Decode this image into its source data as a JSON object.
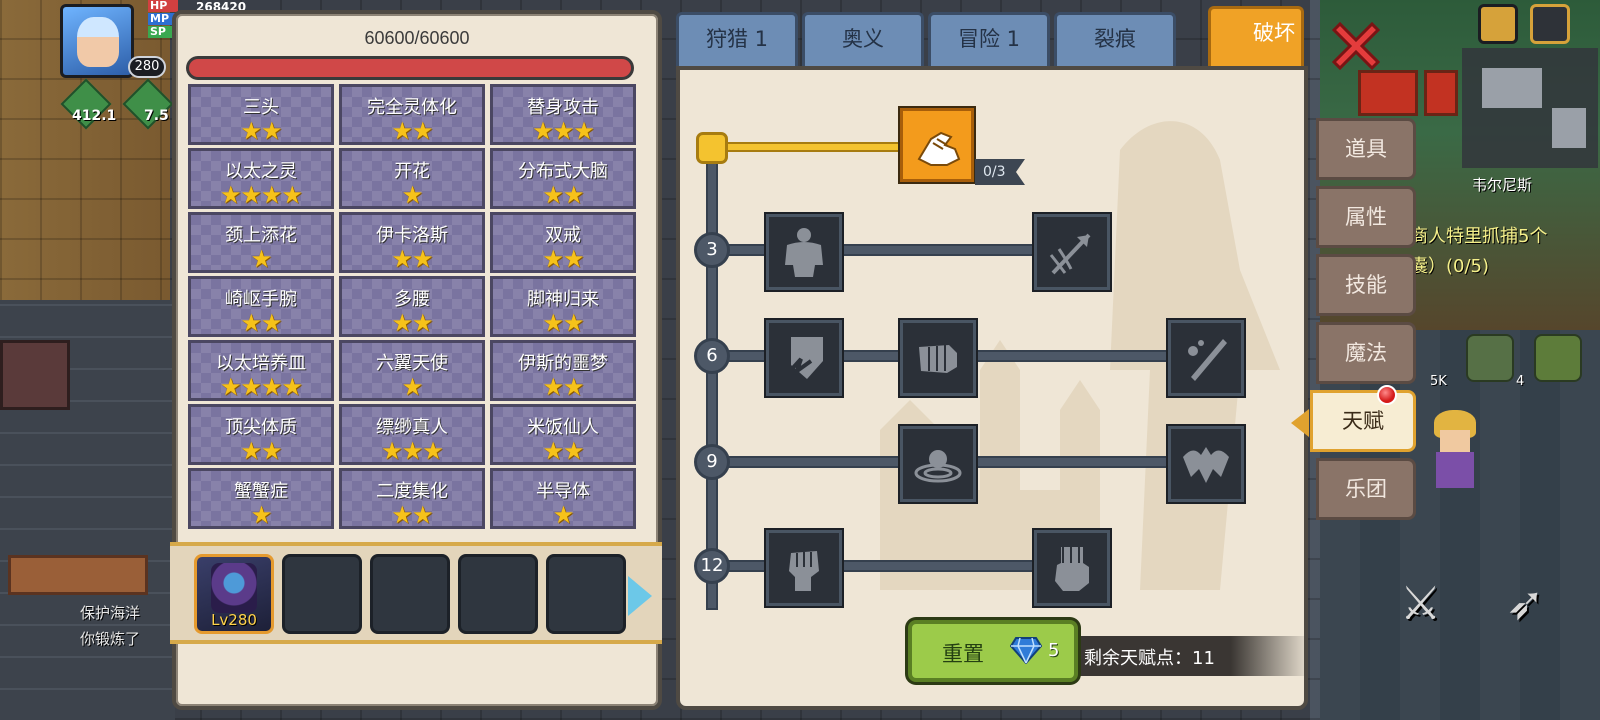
{
  "hud": {
    "hp_label": "HP",
    "mp_label": "MP",
    "sp_label": "SP",
    "hp_value": "268420",
    "level": "280",
    "buffs": [
      "412.1",
      "7.5"
    ]
  },
  "world": {
    "left_messages": [
      "保护海洋",
      "你锻炼了"
    ],
    "npc_name": "韦尔尼斯",
    "quest_lines": [
      "商人特里抓捕5个",
      "囊）(0/5)"
    ],
    "inventory_counts": [
      "5K",
      "4"
    ]
  },
  "traits_panel": {
    "hp_text": "60600/60600",
    "hp_fraction": 1.0,
    "traits": [
      {
        "name": "三头",
        "stars": 2
      },
      {
        "name": "完全灵体化",
        "stars": 2
      },
      {
        "name": "替身攻击",
        "stars": 3
      },
      {
        "name": "以太之灵",
        "stars": 4
      },
      {
        "name": "开花",
        "stars": 1
      },
      {
        "name": "分布式大脑",
        "stars": 2
      },
      {
        "name": "颈上添花",
        "stars": 1
      },
      {
        "name": "伊卡洛斯",
        "stars": 2
      },
      {
        "name": "双戒",
        "stars": 2
      },
      {
        "name": "崎岖手腕",
        "stars": 2
      },
      {
        "name": "多腰",
        "stars": 2
      },
      {
        "name": "脚神归来",
        "stars": 2
      },
      {
        "name": "以太培养皿",
        "stars": 4
      },
      {
        "name": "六翼天使",
        "stars": 1
      },
      {
        "name": "伊斯的噩梦",
        "stars": 2
      },
      {
        "name": "顶尖体质",
        "stars": 2
      },
      {
        "name": "缥缈真人",
        "stars": 3
      },
      {
        "name": "米饭仙人",
        "stars": 2
      },
      {
        "name": "蟹蟹症",
        "stars": 1
      },
      {
        "name": "二度集化",
        "stars": 2
      },
      {
        "name": "半导体",
        "stars": 1
      }
    ],
    "pet_level": "Lv280"
  },
  "tabs": [
    "狩猎 1",
    "奥义",
    "冒险 1",
    "裂痕",
    "破坏"
  ],
  "active_tab": "破坏",
  "talent_tree": {
    "root_count": "0/3",
    "tiers": [
      "3",
      "6",
      "9",
      "12"
    ],
    "reset_label": "重置",
    "reset_cost": "5",
    "points_label": "剩余天赋点：11"
  },
  "side_menu": [
    "道具",
    "属性",
    "技能",
    "魔法",
    "天赋",
    "乐团"
  ],
  "active_side": "天赋",
  "colors": {
    "accent_orange": "#f0a226",
    "tab_blue": "#6d8db5",
    "hp_red": "#d04848",
    "reset_green": "#9ccb4a",
    "star_gold": "#f6c21a"
  }
}
